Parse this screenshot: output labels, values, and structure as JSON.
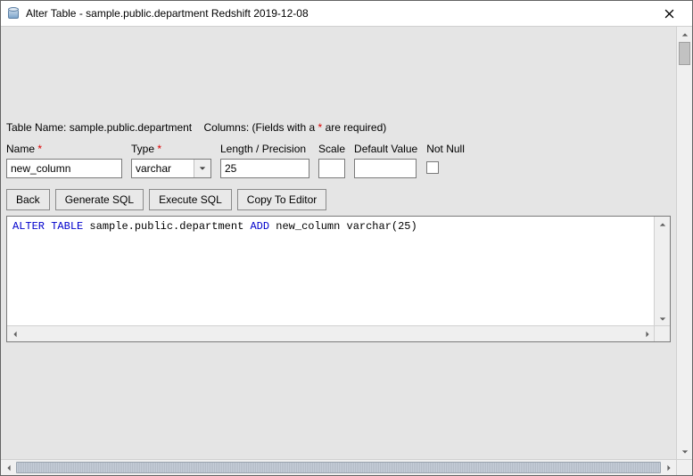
{
  "window": {
    "title": "Alter Table - sample.public.department Redshift 2019-12-08"
  },
  "header": {
    "table_name_label": "Table Name:",
    "table_name_value": "sample.public.department",
    "columns_label": "Columns: (Fields with a",
    "columns_label_after": "are required)"
  },
  "fields": {
    "name": {
      "label": "Name",
      "required": true,
      "value": "new_column"
    },
    "type": {
      "label": "Type",
      "required": true,
      "value": "varchar"
    },
    "length": {
      "label": "Length / Precision",
      "required": false,
      "value": "25"
    },
    "scale": {
      "label": "Scale",
      "required": false,
      "value": ""
    },
    "default": {
      "label": "Default Value",
      "required": false,
      "value": ""
    },
    "notnull": {
      "label": "Not Null",
      "required": false,
      "checked": false
    }
  },
  "buttons": {
    "back": "Back",
    "generate": "Generate SQL",
    "execute": "Execute SQL",
    "copy": "Copy To Editor"
  },
  "sql": {
    "kw1": "ALTER",
    "kw2": "TABLE",
    "mid": " sample.public.department ",
    "kw3": "ADD",
    "rest": " new_column varchar(25)"
  }
}
